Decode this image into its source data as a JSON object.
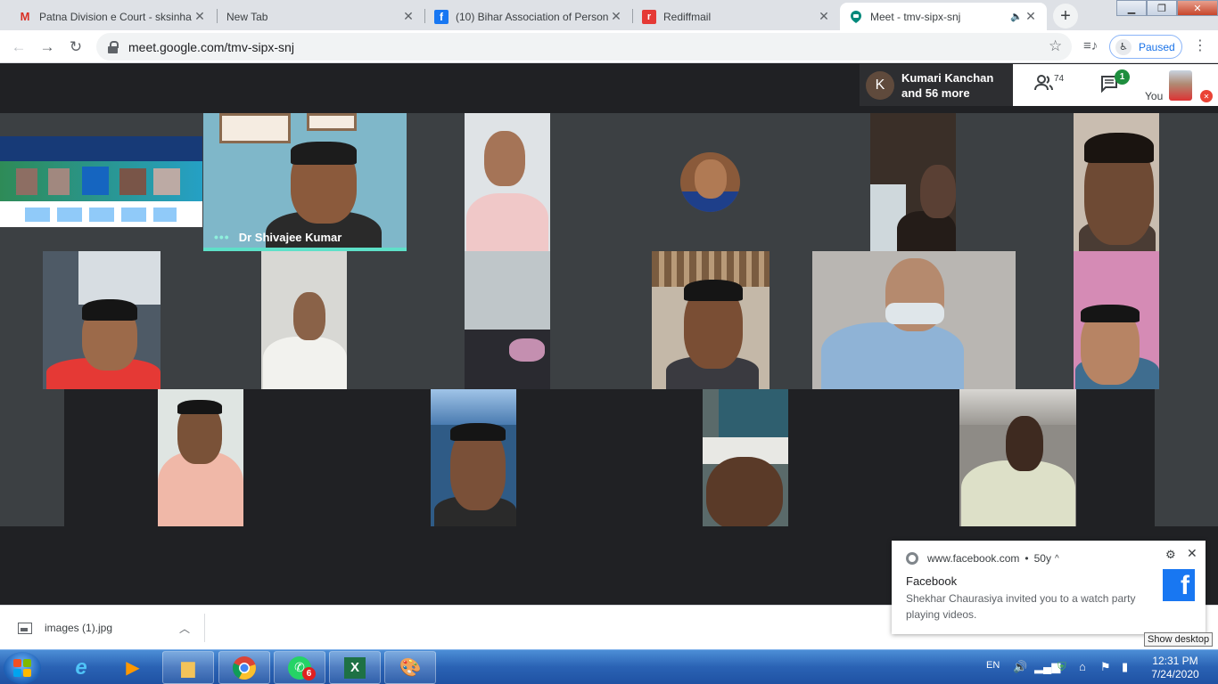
{
  "tabs": [
    {
      "title": "Patna Division e Court - sksinha",
      "icon": "gmail-icon"
    },
    {
      "title": "New Tab",
      "icon": ""
    },
    {
      "title": "(10) Bihar Association of Person",
      "icon": "facebook-icon"
    },
    {
      "title": "Rediffmail",
      "icon": "rediff-icon"
    },
    {
      "title": "Meet - tmv-sipx-snj",
      "icon": "meet-icon",
      "active": true
    }
  ],
  "toolbar": {
    "url": "meet.google.com/tmv-sipx-snj",
    "paused_label": "Paused"
  },
  "meet": {
    "presenter_initial": "K",
    "presenter_line1": "Kumari Kanchan",
    "presenter_line2": "and 56 more",
    "people_count": "74",
    "chat_badge": "1",
    "self_label": "You",
    "active_speaker": "Dr Shivajee Kumar"
  },
  "download": {
    "filename": "images (1).jpg"
  },
  "notification": {
    "source": "www.facebook.com",
    "age": "50y",
    "title": "Facebook",
    "body": "Shekhar Chaurasiya invited you to a watch party playing videos."
  },
  "show_desktop": "Show desktop",
  "taskbar": {
    "whatsapp_badge": "6",
    "language": "EN",
    "time": "12:31 PM",
    "date": "7/24/2020"
  },
  "colors": {
    "meet_bg": "#202124",
    "tile_gap": "#3c4043",
    "active_speaker_bar": "#5ee0c8",
    "chat_badge": "#1e8e3e"
  }
}
